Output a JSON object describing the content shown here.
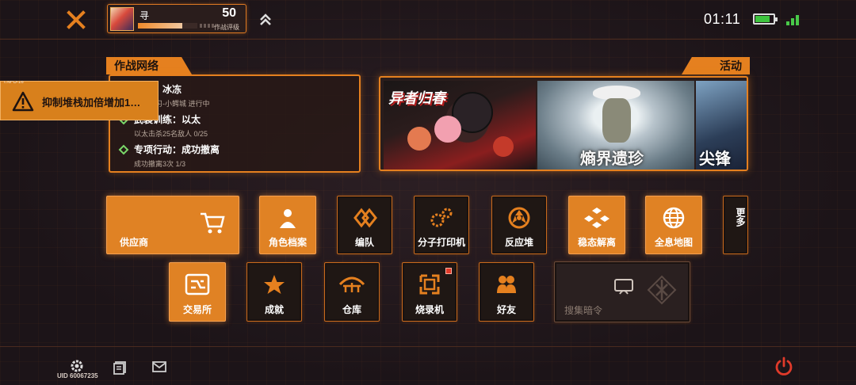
{
  "header": {
    "player_name": "寻",
    "combat_score": "50",
    "combat_label": "作战评级",
    "combat_progress": 0.75,
    "time": "01:11",
    "battery_level": 0.85
  },
  "sections": {
    "network_title": "作战网络",
    "activity_title": "活动"
  },
  "tasks": [
    {
      "title": "补习：冰冻",
      "sub": "冰冻补习-小鳄城 进行中"
    },
    {
      "title": "武装训练：以太",
      "sub": "以太击杀25名敌人 0/25"
    },
    {
      "title": "专项行动：成功撤离",
      "sub": "成功撤离3次 1/3"
    }
  ],
  "banners": [
    {
      "title": "异者归春"
    },
    {
      "title": "熵界遗珍"
    },
    {
      "title": "尖锋"
    }
  ],
  "alert": {
    "tag": "I.NFO-16",
    "text": "抑制堆栈加倍增加1…"
  },
  "menu": {
    "supplier": "供应商",
    "character_files": "角色档案",
    "formation": "编队",
    "molecular_printer": "分子打印机",
    "reactor": "反应堆",
    "metastable_dissociation": "稳态解离",
    "holo_map": "全息地图",
    "more": "更多",
    "exchange": "交易所",
    "achievements": "成就",
    "warehouse": "仓库",
    "burner": "烧录机",
    "friends": "好友",
    "search_cipher": "搜集暗令"
  },
  "footer": {
    "uid": "UID 60067235"
  },
  "colors": {
    "accent": "#e5801f",
    "background": "#1e1519",
    "alert": "#d8801c"
  }
}
